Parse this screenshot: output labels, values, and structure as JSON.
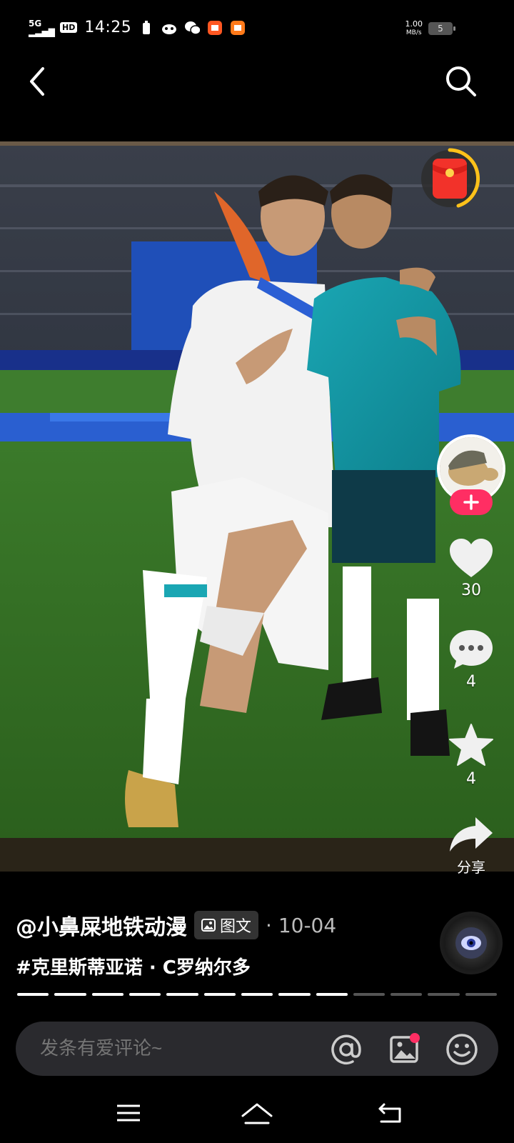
{
  "status_bar": {
    "network": "5G",
    "hd": "HD",
    "time": "14:25",
    "speed_value": "1.00",
    "speed_unit": "MB/s",
    "battery": "5"
  },
  "post": {
    "author": "@小鼻屎地铁动漫",
    "type_label": "图文",
    "date": "· 10-04",
    "hashtag": "#克里斯蒂亚诺 · C罗纳尔多"
  },
  "actions": {
    "likes": "30",
    "comments": "4",
    "favorites": "4",
    "share_label": "分享"
  },
  "progress": {
    "total": 13,
    "done": 9
  },
  "comment_bar": {
    "placeholder": "发条有爱评论~"
  },
  "colors": {
    "accent": "#ff2e63",
    "redpacket_ring": "#ffc21a"
  }
}
